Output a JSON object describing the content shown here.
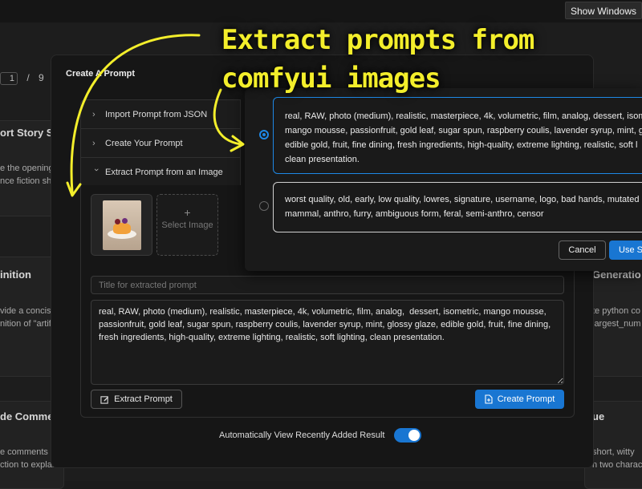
{
  "window": {
    "show_windows_label": "Show Windows"
  },
  "background": {
    "pager": {
      "current": "1",
      "separator": "/",
      "total": "9"
    },
    "cards": [
      {
        "title": "ort Story Sta",
        "lines": [
          "e the opening",
          "nce fiction sh"
        ]
      },
      {
        "title": "inition",
        "lines": [
          "vide a concise",
          "nition of \"artif"
        ]
      },
      {
        "title": "de Comme",
        "lines": [
          "e comments to",
          "ction to explai"
        ]
      },
      {
        "title": "Generatio",
        "lines": [
          "te python co",
          "largest_num"
        ]
      },
      {
        "title": "ue",
        "lines": [
          "short, witty",
          "n two charac"
        ]
      }
    ]
  },
  "modal": {
    "title": "Create A Prompt",
    "accordion": [
      {
        "label": "Import Prompt from JSON"
      },
      {
        "label": "Create Your Prompt"
      },
      {
        "label": "Extract Prompt from an Image"
      }
    ],
    "select_image_label": "Select Image",
    "title_placeholder": "Title for extracted prompt",
    "prompt_text": "real, RAW, photo (medium), realistic, masterpiece, 4k, volumetric, film, analog,  dessert, isometric, mango mousse, passionfruit, gold leaf, sugar spun, raspberry coulis, lavender syrup, mint, glossy glaze, edible gold, fruit, fine dining, fresh ingredients, high-quality, extreme lighting, realistic, soft lighting, clean presentation.",
    "extract_button": "Extract Prompt",
    "create_button": "Create Prompt",
    "toggle_label": "Automatically View Recently Added Result",
    "toggle_on": true
  },
  "popover": {
    "positive_lines": [
      "real, RAW, photo (medium), realistic, masterpiece, 4k, volumetric, film, analog,  dessert, isom",
      "mango mousse, passionfruit, gold leaf, sugar spun, raspberry coulis, lavender syrup, mint, g",
      "edible gold, fruit, fine dining, fresh ingredients, high-quality, extreme lighting, realistic, soft l",
      "clean presentation."
    ],
    "negative_lines": [
      "worst quality, old, early, low quality, lowres, signature, username, logo, bad hands, mutated h",
      "mammal, anthro, furry, ambiguous form, feral, semi-anthro, censor"
    ],
    "cancel_button": "Cancel",
    "use_button": "Use S"
  },
  "annotation": {
    "lines": [
      "Extract prompts from",
      "comfyui images"
    ]
  },
  "colors": {
    "accent": "#1976d2",
    "annotation": "#f3ee2b"
  }
}
